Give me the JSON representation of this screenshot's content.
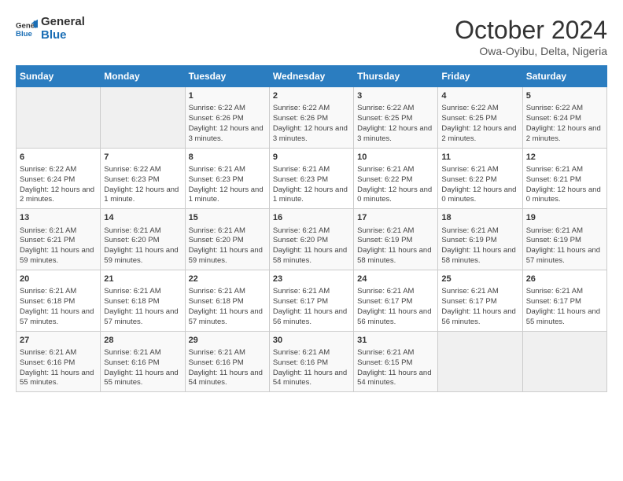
{
  "header": {
    "logo_line1": "General",
    "logo_line2": "Blue",
    "month": "October 2024",
    "location": "Owa-Oyibu, Delta, Nigeria"
  },
  "days_of_week": [
    "Sunday",
    "Monday",
    "Tuesday",
    "Wednesday",
    "Thursday",
    "Friday",
    "Saturday"
  ],
  "weeks": [
    [
      {
        "day": "",
        "empty": true
      },
      {
        "day": "",
        "empty": true
      },
      {
        "day": "1",
        "sunrise": "Sunrise: 6:22 AM",
        "sunset": "Sunset: 6:26 PM",
        "daylight": "Daylight: 12 hours and 3 minutes."
      },
      {
        "day": "2",
        "sunrise": "Sunrise: 6:22 AM",
        "sunset": "Sunset: 6:26 PM",
        "daylight": "Daylight: 12 hours and 3 minutes."
      },
      {
        "day": "3",
        "sunrise": "Sunrise: 6:22 AM",
        "sunset": "Sunset: 6:25 PM",
        "daylight": "Daylight: 12 hours and 3 minutes."
      },
      {
        "day": "4",
        "sunrise": "Sunrise: 6:22 AM",
        "sunset": "Sunset: 6:25 PM",
        "daylight": "Daylight: 12 hours and 2 minutes."
      },
      {
        "day": "5",
        "sunrise": "Sunrise: 6:22 AM",
        "sunset": "Sunset: 6:24 PM",
        "daylight": "Daylight: 12 hours and 2 minutes."
      }
    ],
    [
      {
        "day": "6",
        "sunrise": "Sunrise: 6:22 AM",
        "sunset": "Sunset: 6:24 PM",
        "daylight": "Daylight: 12 hours and 2 minutes."
      },
      {
        "day": "7",
        "sunrise": "Sunrise: 6:22 AM",
        "sunset": "Sunset: 6:23 PM",
        "daylight": "Daylight: 12 hours and 1 minute."
      },
      {
        "day": "8",
        "sunrise": "Sunrise: 6:21 AM",
        "sunset": "Sunset: 6:23 PM",
        "daylight": "Daylight: 12 hours and 1 minute."
      },
      {
        "day": "9",
        "sunrise": "Sunrise: 6:21 AM",
        "sunset": "Sunset: 6:23 PM",
        "daylight": "Daylight: 12 hours and 1 minute."
      },
      {
        "day": "10",
        "sunrise": "Sunrise: 6:21 AM",
        "sunset": "Sunset: 6:22 PM",
        "daylight": "Daylight: 12 hours and 0 minutes."
      },
      {
        "day": "11",
        "sunrise": "Sunrise: 6:21 AM",
        "sunset": "Sunset: 6:22 PM",
        "daylight": "Daylight: 12 hours and 0 minutes."
      },
      {
        "day": "12",
        "sunrise": "Sunrise: 6:21 AM",
        "sunset": "Sunset: 6:21 PM",
        "daylight": "Daylight: 12 hours and 0 minutes."
      }
    ],
    [
      {
        "day": "13",
        "sunrise": "Sunrise: 6:21 AM",
        "sunset": "Sunset: 6:21 PM",
        "daylight": "Daylight: 11 hours and 59 minutes."
      },
      {
        "day": "14",
        "sunrise": "Sunrise: 6:21 AM",
        "sunset": "Sunset: 6:20 PM",
        "daylight": "Daylight: 11 hours and 59 minutes."
      },
      {
        "day": "15",
        "sunrise": "Sunrise: 6:21 AM",
        "sunset": "Sunset: 6:20 PM",
        "daylight": "Daylight: 11 hours and 59 minutes."
      },
      {
        "day": "16",
        "sunrise": "Sunrise: 6:21 AM",
        "sunset": "Sunset: 6:20 PM",
        "daylight": "Daylight: 11 hours and 58 minutes."
      },
      {
        "day": "17",
        "sunrise": "Sunrise: 6:21 AM",
        "sunset": "Sunset: 6:19 PM",
        "daylight": "Daylight: 11 hours and 58 minutes."
      },
      {
        "day": "18",
        "sunrise": "Sunrise: 6:21 AM",
        "sunset": "Sunset: 6:19 PM",
        "daylight": "Daylight: 11 hours and 58 minutes."
      },
      {
        "day": "19",
        "sunrise": "Sunrise: 6:21 AM",
        "sunset": "Sunset: 6:19 PM",
        "daylight": "Daylight: 11 hours and 57 minutes."
      }
    ],
    [
      {
        "day": "20",
        "sunrise": "Sunrise: 6:21 AM",
        "sunset": "Sunset: 6:18 PM",
        "daylight": "Daylight: 11 hours and 57 minutes."
      },
      {
        "day": "21",
        "sunrise": "Sunrise: 6:21 AM",
        "sunset": "Sunset: 6:18 PM",
        "daylight": "Daylight: 11 hours and 57 minutes."
      },
      {
        "day": "22",
        "sunrise": "Sunrise: 6:21 AM",
        "sunset": "Sunset: 6:18 PM",
        "daylight": "Daylight: 11 hours and 57 minutes."
      },
      {
        "day": "23",
        "sunrise": "Sunrise: 6:21 AM",
        "sunset": "Sunset: 6:17 PM",
        "daylight": "Daylight: 11 hours and 56 minutes."
      },
      {
        "day": "24",
        "sunrise": "Sunrise: 6:21 AM",
        "sunset": "Sunset: 6:17 PM",
        "daylight": "Daylight: 11 hours and 56 minutes."
      },
      {
        "day": "25",
        "sunrise": "Sunrise: 6:21 AM",
        "sunset": "Sunset: 6:17 PM",
        "daylight": "Daylight: 11 hours and 56 minutes."
      },
      {
        "day": "26",
        "sunrise": "Sunrise: 6:21 AM",
        "sunset": "Sunset: 6:17 PM",
        "daylight": "Daylight: 11 hours and 55 minutes."
      }
    ],
    [
      {
        "day": "27",
        "sunrise": "Sunrise: 6:21 AM",
        "sunset": "Sunset: 6:16 PM",
        "daylight": "Daylight: 11 hours and 55 minutes."
      },
      {
        "day": "28",
        "sunrise": "Sunrise: 6:21 AM",
        "sunset": "Sunset: 6:16 PM",
        "daylight": "Daylight: 11 hours and 55 minutes."
      },
      {
        "day": "29",
        "sunrise": "Sunrise: 6:21 AM",
        "sunset": "Sunset: 6:16 PM",
        "daylight": "Daylight: 11 hours and 54 minutes."
      },
      {
        "day": "30",
        "sunrise": "Sunrise: 6:21 AM",
        "sunset": "Sunset: 6:16 PM",
        "daylight": "Daylight: 11 hours and 54 minutes."
      },
      {
        "day": "31",
        "sunrise": "Sunrise: 6:21 AM",
        "sunset": "Sunset: 6:15 PM",
        "daylight": "Daylight: 11 hours and 54 minutes."
      },
      {
        "day": "",
        "empty": true
      },
      {
        "day": "",
        "empty": true
      }
    ]
  ]
}
